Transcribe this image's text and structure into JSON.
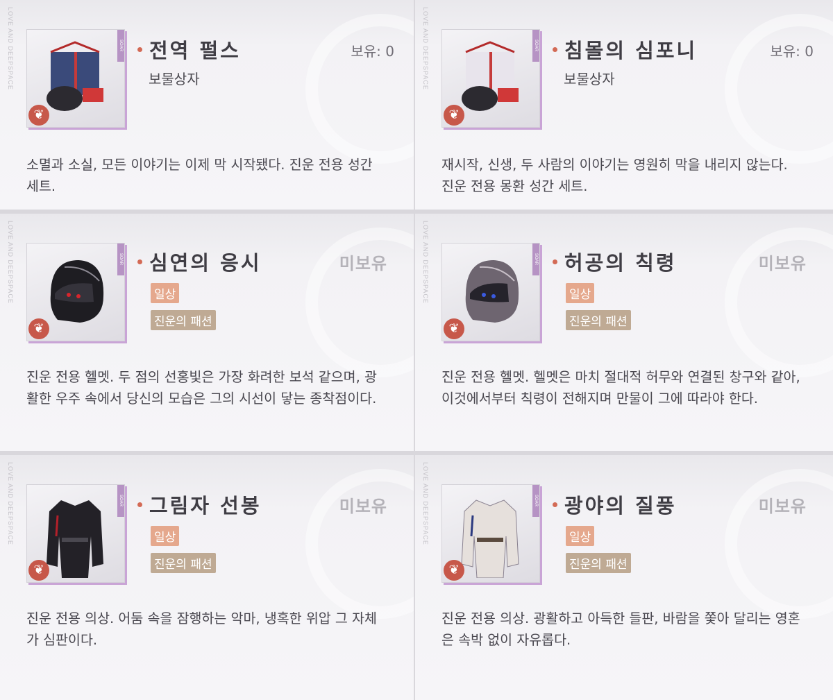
{
  "side_watermark": "LOVE AND DEEPSPACE",
  "thumb_tag": "SOAR",
  "items": [
    {
      "title": "전역 펄스",
      "status": "보유: 0",
      "subtype": "보물상자",
      "desc": "소멸과 소실, 모든 이야기는 이제 막 시작됐다. 진운 전용 성간 세트.",
      "icon": "gift-box-icon"
    },
    {
      "title": "침몰의 심포니",
      "status": "보유: 0",
      "subtype": "보물상자",
      "desc": "재시작, 신생, 두 사람의 이야기는 영원히 막을 내리지 않는다. 진운 전용 몽환 성간 세트.",
      "icon": "gift-box-icon"
    },
    {
      "title": "심연의 응시",
      "status": "미보유",
      "tag_daily": "일상",
      "tag_fashion": "진운의 패션",
      "desc": "진운 전용 헬멧. 두 점의 선홍빛은 가장 화려한 보석 같으며, 광활한 우주 속에서 당신의 모습은 그의 시선이 닿는 종착점이다.",
      "icon": "helmet-icon"
    },
    {
      "title": "허공의 칙령",
      "status": "미보유",
      "tag_daily": "일상",
      "tag_fashion": "진운의 패션",
      "desc": "진운 전용 헬멧. 헬멧은 마치 절대적 허무와 연결된 창구와 같아, 이것에서부터 칙령이 전해지며 만물이 그에 따라야 한다.",
      "icon": "helmet-icon"
    },
    {
      "title": "그림자 선봉",
      "status": "미보유",
      "tag_daily": "일상",
      "tag_fashion": "진운의 패션",
      "desc": "진운 전용 의상. 어둠 속을 잠행하는 악마, 냉혹한 위압 그 자체가 심판이다.",
      "icon": "outfit-icon"
    },
    {
      "title": "광야의 질풍",
      "status": "미보유",
      "tag_daily": "일상",
      "tag_fashion": "진운의 패션",
      "desc": "진운 전용 의상. 광활하고 아득한 들판, 바람을 쫓아 달리는 영혼은 속박 없이 자유롭다.",
      "icon": "outfit-icon"
    }
  ],
  "colors": {
    "accent_dot": "#d36a55",
    "badge_daily": "#e5a88d",
    "badge_fashion": "#bfaa94",
    "thumb_border": "#c9a4d6"
  }
}
